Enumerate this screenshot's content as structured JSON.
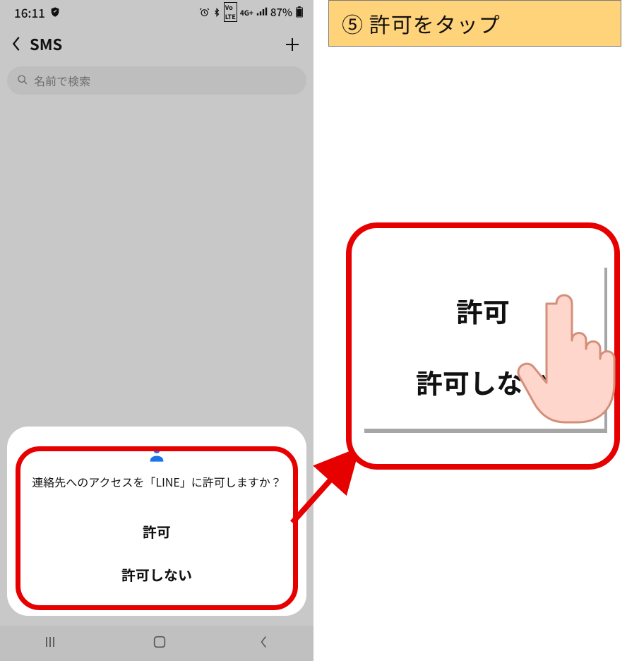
{
  "banner": {
    "text": "⑤ 許可をタップ"
  },
  "status": {
    "time": "16:11",
    "battery": "87%"
  },
  "header": {
    "title": "SMS"
  },
  "search": {
    "placeholder": "名前で検索"
  },
  "dialog": {
    "message": "連絡先へのアクセスを「LINE」に許可しますか？",
    "allow": "許可",
    "deny": "許可しない"
  },
  "zoom": {
    "allow": "許可",
    "deny": "許可しない"
  }
}
